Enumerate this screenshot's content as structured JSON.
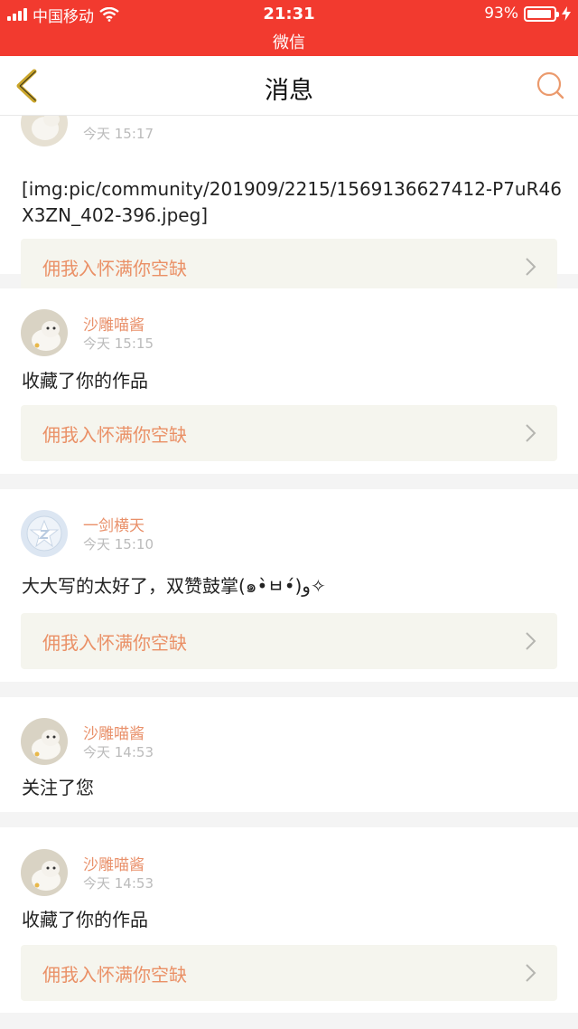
{
  "status_bar": {
    "carrier": "中国移动",
    "time": "21:31",
    "app_name": "微信",
    "battery_text": "93%",
    "battery_level": 0.93
  },
  "nav": {
    "title": "消息"
  },
  "messages": [
    {
      "user": "",
      "time": "今天 15:17",
      "text": "[img:pic/community/201909/2215/1569136627412-P7uR46X3ZN_402-396.jpeg]",
      "article": "佣我入怀满你空缺"
    },
    {
      "user": "沙雕喵酱",
      "time": "今天 15:15",
      "text": "收藏了你的作品",
      "article": "佣我入怀满你空缺"
    },
    {
      "user": "一剑横天",
      "time": "今天 15:10",
      "text": "大大写的太好了，双赞鼓掌(๑•̀ㅂ•́)و✧",
      "article": "佣我入怀满你空缺"
    },
    {
      "user": "沙雕喵酱",
      "time": "今天 14:53",
      "text": "关注了您"
    },
    {
      "user": "沙雕喵酱",
      "time": "今天 14:53",
      "text": "收藏了你的作品",
      "article": "佣我入怀满你空缺"
    }
  ],
  "colors": {
    "status_bar_bg": "#f23a2f",
    "accent": "#e9906a",
    "article_bg": "#f5f5ee"
  }
}
